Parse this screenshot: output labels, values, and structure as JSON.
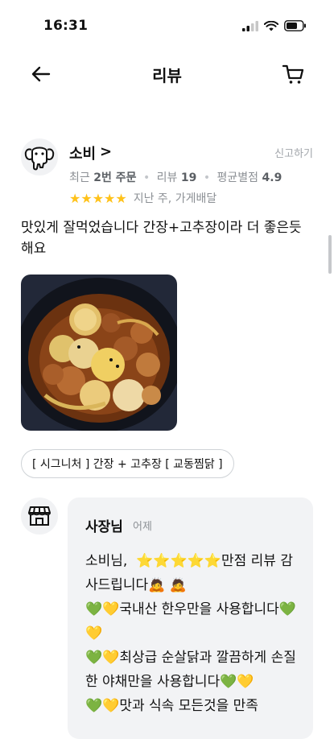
{
  "status": {
    "time": "16:31"
  },
  "nav": {
    "title": "리뷰"
  },
  "review": {
    "reviewer_name": "소비",
    "chevron": ">",
    "report_label": "신고하기",
    "recent_orders_prefix": "최근",
    "recent_orders": "2번 주문",
    "review_count_label": "리뷰",
    "review_count": "19",
    "avg_rating_label": "평균별점",
    "avg_rating": "4.9",
    "stars": "★★★★★",
    "rating": 5,
    "time_and_type": "지난 주, 가게배달",
    "text": "맛있게 잘먹었습니다 간장+고추장이라 더 좋은듯해요",
    "menu_tag": "[ 시그니처 ] 간장 + 고추장 [ 교동찜닭 ]"
  },
  "reply": {
    "owner_name": "사장님",
    "time": "어제",
    "text": "소비님,  ⭐⭐⭐⭐⭐만점 리뷰 감사드립니다🙇 🙇\n💚💛국내산 한우만을 사용합니다💚💛\n💚💛최상급 순살닭과 깔끔하게 손질한 야채만을 사용합니다💚💛\n💚💛맛과 식속 모든것을 만족"
  },
  "colors": {
    "star": "#ffc21a",
    "muted": "#8c9095",
    "reply_bg": "#f2f3f5"
  },
  "icons": {
    "back": "arrow-left-icon",
    "cart": "cart-icon",
    "reviewer_avatar": "elephant-avatar-icon",
    "owner_avatar": "store-icon"
  }
}
